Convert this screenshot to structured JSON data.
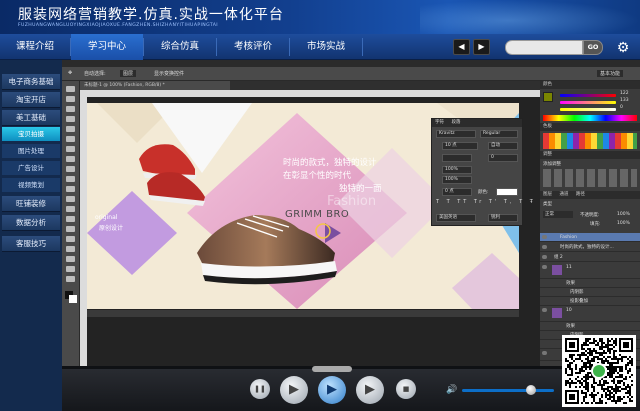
{
  "header": {
    "title": "服装网络营销教学.仿真.实战一体化平台",
    "subtitle": "FUZHUANGWANGLUOYINGXIAOJIAOXUE.FANGZHEN.SHIZHANYITIHUAPINGTAI"
  },
  "nav": {
    "items": [
      {
        "label": "课程介绍",
        "active": false
      },
      {
        "label": "学习中心",
        "active": true
      },
      {
        "label": "综合仿真",
        "active": false
      },
      {
        "label": "考核评价",
        "active": false
      },
      {
        "label": "市场实战",
        "active": false
      }
    ],
    "prev_icon": "◀",
    "next_icon": "▶",
    "search_placeholder": "",
    "go_label": "GO"
  },
  "sidebar": {
    "items": [
      {
        "label": "电子商务基础",
        "type": "main",
        "active": false
      },
      {
        "label": "淘宝开店",
        "type": "main",
        "active": false
      },
      {
        "label": "美工基础",
        "type": "main",
        "active": false
      },
      {
        "label": "宝贝拍摄",
        "type": "sub",
        "active": true
      },
      {
        "label": "图片处理",
        "type": "sub",
        "active": false
      },
      {
        "label": "广告设计",
        "type": "sub",
        "active": false
      },
      {
        "label": "视频策划",
        "type": "sub",
        "active": false
      },
      {
        "label": "旺铺装修",
        "type": "main",
        "active": false
      },
      {
        "label": "数据分析",
        "type": "main",
        "active": false
      },
      {
        "label": "客服技巧",
        "type": "main",
        "active": false
      }
    ]
  },
  "photoshop": {
    "options": {
      "auto_select": "自动选择:",
      "layer_mode": "图层",
      "show_transform": "显示变换控件"
    },
    "doc_tab": "未标题-1 @ 100% (Fashion, RGB/8) *",
    "workspace": "基本功能",
    "canvas": {
      "headline_1": "时尚的款式，独特的设计",
      "headline_2": "在彰显个性的时代",
      "headline_3": "独特的一面",
      "brand": "GRIMM BRO",
      "ghost_text": "Fashion",
      "tag_en": "original",
      "tag_cn": "原创设计"
    },
    "char_panel": {
      "tabs": [
        "字符",
        "段落"
      ],
      "font": "Kravitz",
      "style": "Regular",
      "size": "10 点",
      "leading": "自动",
      "tracking": "0",
      "scale": "100%",
      "baseline": "0 点",
      "color_label": "颜色:",
      "lang": "美国英语",
      "aa": "锐利"
    },
    "color_panel": {
      "title": "颜色",
      "r": "122",
      "g": "133",
      "b": "0"
    },
    "swatch_title": "色板",
    "adjust_title": "调整",
    "adjust_sub": "添加调整",
    "layers": {
      "tabs": [
        "图层",
        "通道",
        "路径"
      ],
      "kind": "类型",
      "mode": "正常",
      "opacity_label": "不透明度:",
      "opacity": "100%",
      "fill_label": "填充:",
      "fill": "100%",
      "rows": [
        {
          "label": "Fashion",
          "selected": true
        },
        {
          "label": "时尚的款式，独特的设计...",
          "selected": false
        },
        {
          "label": "组 2",
          "selected": false
        },
        {
          "label": "11",
          "selected": false
        },
        {
          "label": "效果",
          "selected": false
        },
        {
          "label": "内阴影",
          "selected": false
        },
        {
          "label": "投影叠加",
          "selected": false
        },
        {
          "label": "10",
          "selected": false
        },
        {
          "label": "效果",
          "selected": false
        },
        {
          "label": "内阴影",
          "selected": false
        },
        {
          "label": "投影叠加",
          "selected": false
        },
        {
          "label": "9",
          "selected": false
        }
      ]
    }
  },
  "player": {
    "pause_icon": "❚❚",
    "play_icon": "▶",
    "stop_icon": "■",
    "volume_icon": "🔊",
    "volume_level": 0.75
  },
  "qr_label": "qr-code"
}
